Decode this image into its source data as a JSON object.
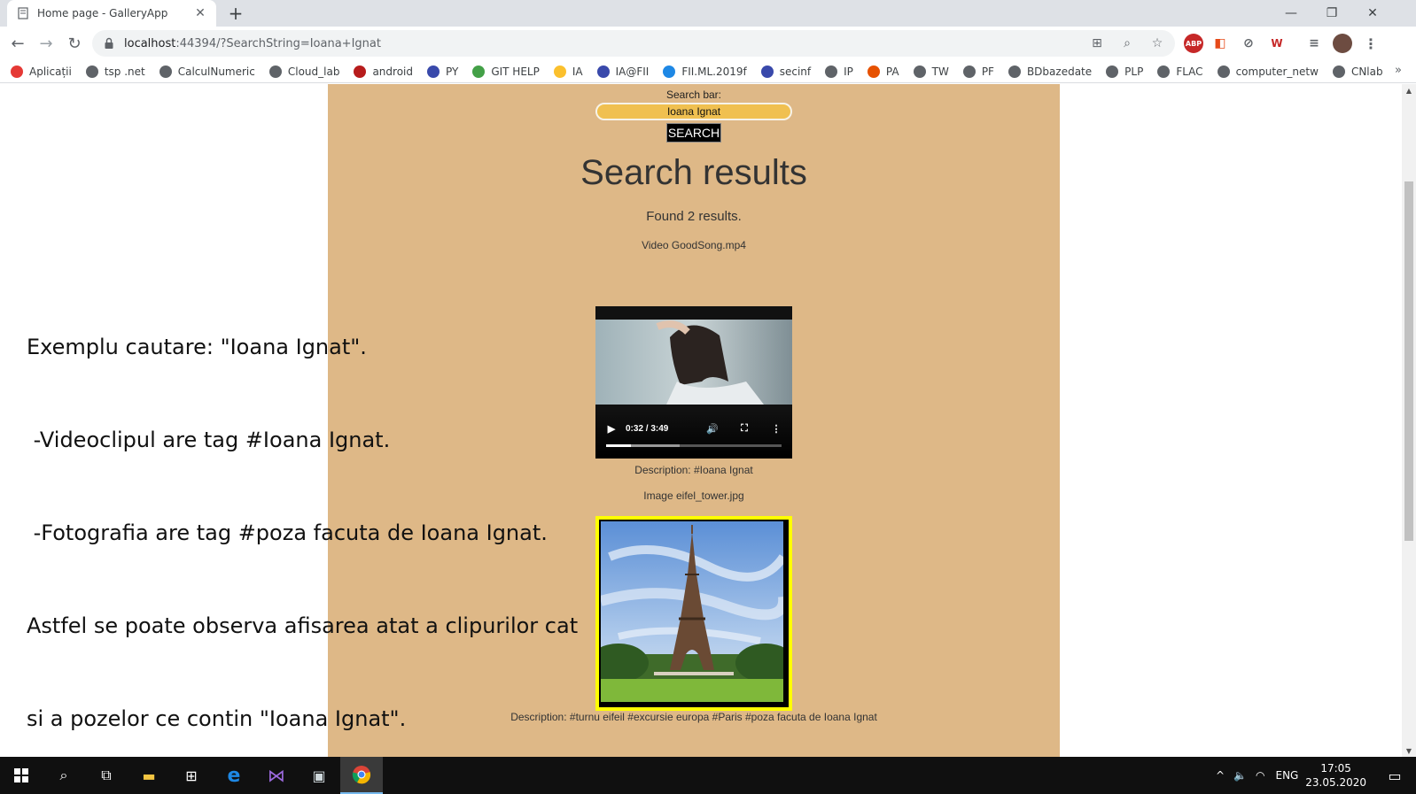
{
  "browser": {
    "tab_title": "Home page - GalleryApp",
    "url_host": "localhost",
    "url_rest": ":44394/?SearchString=Ioana+Ignat",
    "bookmarks": [
      {
        "label": "Aplicații",
        "color": "#e53935"
      },
      {
        "label": "tsp .net",
        "color": "#5f6368"
      },
      {
        "label": "CalculNumeric",
        "color": "#5f6368"
      },
      {
        "label": "Cloud_lab",
        "color": "#5f6368"
      },
      {
        "label": "android",
        "color": "#b71c1c"
      },
      {
        "label": "PY",
        "color": "#3949ab"
      },
      {
        "label": "GIT HELP",
        "color": "#43a047"
      },
      {
        "label": "IA",
        "color": "#fbc02d"
      },
      {
        "label": "IA@FII",
        "color": "#3949ab"
      },
      {
        "label": "FII.ML.2019f",
        "color": "#1e88e5"
      },
      {
        "label": "secinf",
        "color": "#3949ab"
      },
      {
        "label": "IP",
        "color": "#5f6368"
      },
      {
        "label": "PA",
        "color": "#e65100"
      },
      {
        "label": "TW",
        "color": "#5f6368"
      },
      {
        "label": "PF",
        "color": "#5f6368"
      },
      {
        "label": "BDbazedate",
        "color": "#5f6368"
      },
      {
        "label": "PLP",
        "color": "#5f6368"
      },
      {
        "label": "FLAC",
        "color": "#5f6368"
      },
      {
        "label": "computer_netw",
        "color": "#5f6368"
      },
      {
        "label": "CNlab",
        "color": "#5f6368"
      }
    ],
    "bookmarks_more": "»"
  },
  "page": {
    "search_label": "Search bar:",
    "search_value": "Ioana Ignat",
    "search_button": "SEARCH",
    "results_title": "Search results",
    "found_text": "Found 2 results.",
    "video_caption": "Video GoodSong.mp4",
    "video_time": "0:32 / 3:49",
    "video_progress": 0.14,
    "video_buffered": 0.42,
    "video_description": "Description: #Ioana Ignat",
    "image_caption": "Image eifel_tower.jpg",
    "image_description": "Description: #turnu eifeil #excursie europa #Paris #poza facuta de Ioana Ignat"
  },
  "overlay": {
    "lines": [
      "Exemplu cautare: \"Ioana Ignat\".",
      " -Videoclipul are tag #Ioana Ignat.",
      " -Fotografia are tag #poza facuta de Ioana Ignat.",
      "Astfel se poate observa afisarea atat a clipurilor cat",
      "si a pozelor ce contin \"Ioana Ignat\"."
    ]
  },
  "taskbar": {
    "language": "ENG",
    "time": "17:05",
    "date": "23.05.2020"
  },
  "colors": {
    "page_bg": "#deb887",
    "search_input": "#f0c050",
    "photo_border": "#ffff00"
  }
}
